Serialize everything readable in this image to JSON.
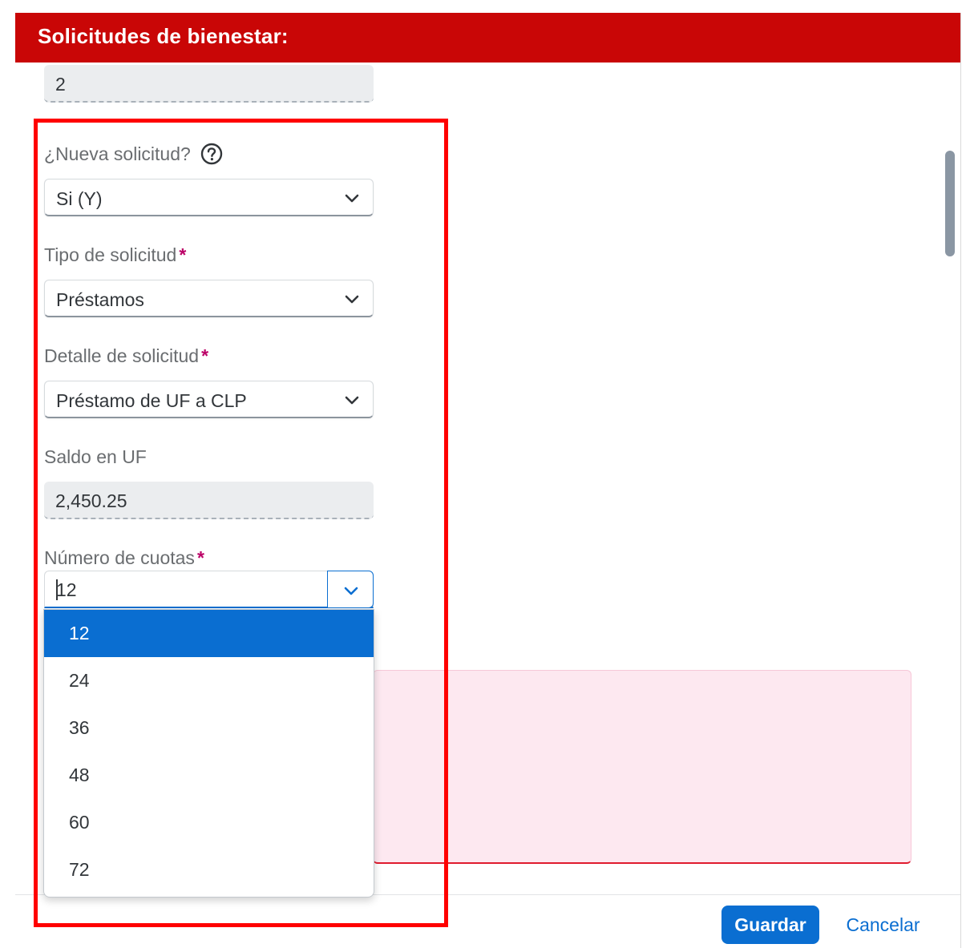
{
  "dialog": {
    "title": "Solicitudes de bienestar:"
  },
  "form": {
    "top_field_value": "2",
    "nueva_solicitud": {
      "label": "¿Nueva solicitud?",
      "value": "Si (Y)"
    },
    "tipo_solicitud": {
      "label": "Tipo de solicitud",
      "required_mark": "*",
      "value": "Préstamos"
    },
    "detalle_solicitud": {
      "label": "Detalle de solicitud",
      "required_mark": "*",
      "value": "Préstamo de UF a CLP"
    },
    "saldo_uf": {
      "label": "Saldo en UF",
      "value": "2,450.25"
    },
    "numero_cuotas": {
      "label": "Número de cuotas",
      "required_mark": "*",
      "input_value": "12",
      "options": [
        "12",
        "24",
        "36",
        "48",
        "60",
        "72"
      ],
      "selected_option": "12"
    }
  },
  "footer": {
    "save_label": "Guardar",
    "cancel_label": "Cancelar"
  },
  "colors": {
    "header": "#c90606",
    "accent": "#0a6ed1",
    "required": "#bb0066",
    "highlight": "#ff0000",
    "error_bg": "#fde8f0"
  }
}
